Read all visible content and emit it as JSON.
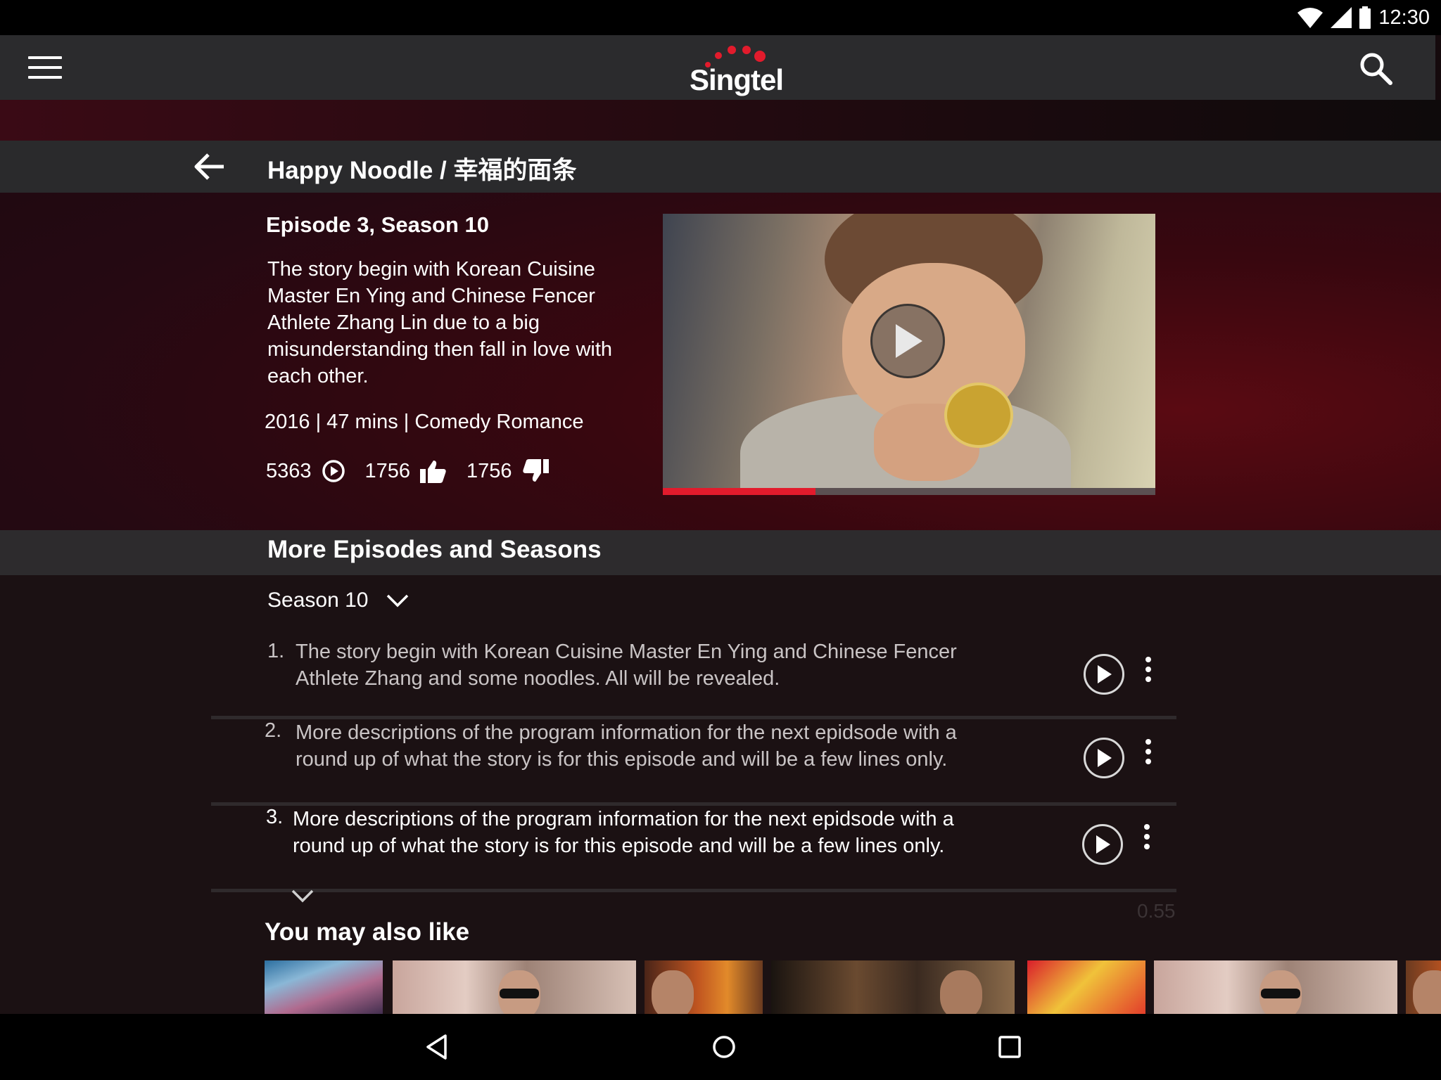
{
  "status_bar": {
    "time": "12:30"
  },
  "app_bar": {
    "logo_text": "Singtel"
  },
  "show": {
    "title": "Happy Noodle / 幸福的面条",
    "episode_title": "Episode 3, Season 10",
    "description": "The story begin with Korean Cuisine Master En Ying and Chinese Fencer Athlete Zhang Lin due to a big misunderstanding then fall in love with each other.",
    "meta": "2016 |  47 mins | Comedy Romance",
    "views": "5363",
    "likes": "1756",
    "dislikes": "1756",
    "playback_progress": 0.31
  },
  "episodes_section": {
    "title": "More Episodes and Seasons",
    "season_label": "Season 10",
    "episodes": [
      {
        "number": "1.",
        "text": "The story begin with Korean Cuisine Master En Ying and Chinese Fencer Athlete Zhang  and some noodles. All will be revealed."
      },
      {
        "number": "2.",
        "text": "More descriptions of the program information for the next epidsode with a round up of what the story is for this episode and will be a few lines only."
      },
      {
        "number": "3.",
        "text": "More descriptions of the program information for the next epidsode with a round up of what the story is for this episode and will be a few lines only."
      }
    ]
  },
  "overlay_timer": "0.55",
  "recommendations": {
    "title": "You may also like"
  },
  "colors": {
    "accent_red": "#e21b2c",
    "app_bar": "#2b2b2d",
    "hero_dark_red": "#38070f"
  }
}
